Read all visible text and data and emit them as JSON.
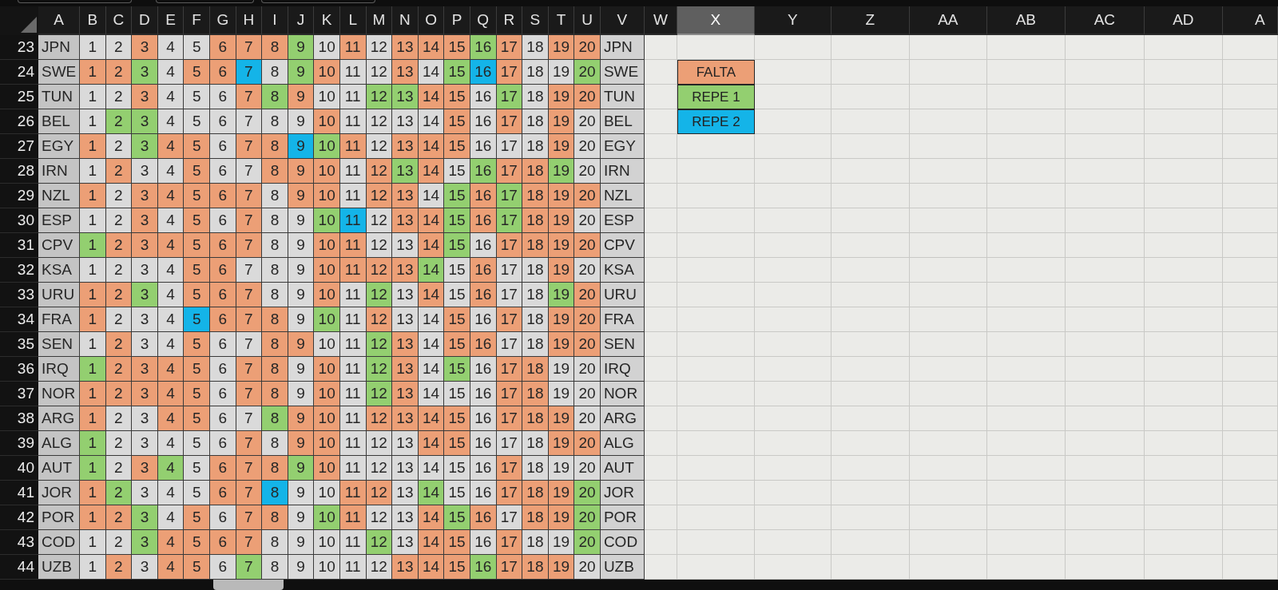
{
  "column_headers": [
    {
      "label": "A",
      "selected": false
    },
    {
      "label": "B",
      "selected": false
    },
    {
      "label": "C",
      "selected": false
    },
    {
      "label": "D",
      "selected": false
    },
    {
      "label": "E",
      "selected": false
    },
    {
      "label": "F",
      "selected": false
    },
    {
      "label": "G",
      "selected": false
    },
    {
      "label": "H",
      "selected": false
    },
    {
      "label": "I",
      "selected": false
    },
    {
      "label": "J",
      "selected": false
    },
    {
      "label": "K",
      "selected": false
    },
    {
      "label": "L",
      "selected": false
    },
    {
      "label": "M",
      "selected": false
    },
    {
      "label": "N",
      "selected": false
    },
    {
      "label": "O",
      "selected": false
    },
    {
      "label": "P",
      "selected": false
    },
    {
      "label": "Q",
      "selected": false
    },
    {
      "label": "R",
      "selected": false
    },
    {
      "label": "S",
      "selected": false
    },
    {
      "label": "T",
      "selected": false
    },
    {
      "label": "U",
      "selected": false
    },
    {
      "label": "V",
      "selected": false
    },
    {
      "label": "W",
      "selected": false
    },
    {
      "label": "X",
      "selected": true
    },
    {
      "label": "Y",
      "selected": false
    },
    {
      "label": "Z",
      "selected": false
    },
    {
      "label": "AA",
      "selected": false
    },
    {
      "label": "AB",
      "selected": false
    },
    {
      "label": "AC",
      "selected": false
    },
    {
      "label": "AD",
      "selected": false
    },
    {
      "label": "A",
      "selected": false
    }
  ],
  "rows": [
    {
      "number": "23",
      "team": "JPN",
      "cells": [
        {
          "text": "1",
          "color": "#dadada"
        },
        {
          "text": "2",
          "color": "#dadada"
        },
        {
          "text": "3",
          "color": "#ec9f76"
        },
        {
          "text": "4",
          "color": "#dadada"
        },
        {
          "text": "5",
          "color": "#dadada"
        },
        {
          "text": "6",
          "color": "#ec9f76"
        },
        {
          "text": "7",
          "color": "#ec9f76"
        },
        {
          "text": "8",
          "color": "#ec9f76"
        },
        {
          "text": "9",
          "color": "#93cf70"
        },
        {
          "text": "10",
          "color": "#dadada"
        },
        {
          "text": "11",
          "color": "#ec9f76"
        },
        {
          "text": "12",
          "color": "#dadada"
        },
        {
          "text": "13",
          "color": "#ec9f76"
        },
        {
          "text": "14",
          "color": "#ec9f76"
        },
        {
          "text": "15",
          "color": "#ec9f76"
        },
        {
          "text": "16",
          "color": "#93cf70"
        },
        {
          "text": "17",
          "color": "#ec9f76"
        },
        {
          "text": "18",
          "color": "#dadada"
        },
        {
          "text": "19",
          "color": "#ec9f76"
        },
        {
          "text": "20",
          "color": "#ec9f76"
        }
      ],
      "team_end": "JPN"
    },
    {
      "number": "24",
      "team": "SWE",
      "cells": [
        {
          "text": "1",
          "color": "#ec9f76"
        },
        {
          "text": "2",
          "color": "#ec9f76"
        },
        {
          "text": "3",
          "color": "#93cf70"
        },
        {
          "text": "4",
          "color": "#dadada"
        },
        {
          "text": "5",
          "color": "#ec9f76"
        },
        {
          "text": "6",
          "color": "#ec9f76"
        },
        {
          "text": "7",
          "color": "#14b4e8"
        },
        {
          "text": "8",
          "color": "#dadada"
        },
        {
          "text": "9",
          "color": "#93cf70"
        },
        {
          "text": "10",
          "color": "#ec9f76"
        },
        {
          "text": "11",
          "color": "#dadada"
        },
        {
          "text": "12",
          "color": "#dadada"
        },
        {
          "text": "13",
          "color": "#ec9f76"
        },
        {
          "text": "14",
          "color": "#dadada"
        },
        {
          "text": "15",
          "color": "#93cf70"
        },
        {
          "text": "16",
          "color": "#14b4e8"
        },
        {
          "text": "17",
          "color": "#ec9f76"
        },
        {
          "text": "18",
          "color": "#dadada"
        },
        {
          "text": "19",
          "color": "#dadada"
        },
        {
          "text": "20",
          "color": "#93cf70"
        }
      ],
      "team_end": "SWE"
    },
    {
      "number": "25",
      "team": "TUN",
      "cells": [
        {
          "text": "1",
          "color": "#dadada"
        },
        {
          "text": "2",
          "color": "#dadada"
        },
        {
          "text": "3",
          "color": "#ec9f76"
        },
        {
          "text": "4",
          "color": "#dadada"
        },
        {
          "text": "5",
          "color": "#dadada"
        },
        {
          "text": "6",
          "color": "#dadada"
        },
        {
          "text": "7",
          "color": "#ec9f76"
        },
        {
          "text": "8",
          "color": "#93cf70"
        },
        {
          "text": "9",
          "color": "#ec9f76"
        },
        {
          "text": "10",
          "color": "#dadada"
        },
        {
          "text": "11",
          "color": "#dadada"
        },
        {
          "text": "12",
          "color": "#93cf70"
        },
        {
          "text": "13",
          "color": "#93cf70"
        },
        {
          "text": "14",
          "color": "#ec9f76"
        },
        {
          "text": "15",
          "color": "#ec9f76"
        },
        {
          "text": "16",
          "color": "#dadada"
        },
        {
          "text": "17",
          "color": "#93cf70"
        },
        {
          "text": "18",
          "color": "#dadada"
        },
        {
          "text": "19",
          "color": "#ec9f76"
        },
        {
          "text": "20",
          "color": "#ec9f76"
        }
      ],
      "team_end": "TUN"
    },
    {
      "number": "26",
      "team": "BEL",
      "cells": [
        {
          "text": "1",
          "color": "#dadada"
        },
        {
          "text": "2",
          "color": "#93cf70"
        },
        {
          "text": "3",
          "color": "#93cf70"
        },
        {
          "text": "4",
          "color": "#dadada"
        },
        {
          "text": "5",
          "color": "#dadada"
        },
        {
          "text": "6",
          "color": "#dadada"
        },
        {
          "text": "7",
          "color": "#dadada"
        },
        {
          "text": "8",
          "color": "#dadada"
        },
        {
          "text": "9",
          "color": "#dadada"
        },
        {
          "text": "10",
          "color": "#ec9f76"
        },
        {
          "text": "11",
          "color": "#dadada"
        },
        {
          "text": "12",
          "color": "#dadada"
        },
        {
          "text": "13",
          "color": "#dadada"
        },
        {
          "text": "14",
          "color": "#dadada"
        },
        {
          "text": "15",
          "color": "#ec9f76"
        },
        {
          "text": "16",
          "color": "#dadada"
        },
        {
          "text": "17",
          "color": "#ec9f76"
        },
        {
          "text": "18",
          "color": "#dadada"
        },
        {
          "text": "19",
          "color": "#ec9f76"
        },
        {
          "text": "20",
          "color": "#dadada"
        }
      ],
      "team_end": "BEL"
    },
    {
      "number": "27",
      "team": "EGY",
      "cells": [
        {
          "text": "1",
          "color": "#ec9f76"
        },
        {
          "text": "2",
          "color": "#dadada"
        },
        {
          "text": "3",
          "color": "#93cf70"
        },
        {
          "text": "4",
          "color": "#ec9f76"
        },
        {
          "text": "5",
          "color": "#ec9f76"
        },
        {
          "text": "6",
          "color": "#dadada"
        },
        {
          "text": "7",
          "color": "#ec9f76"
        },
        {
          "text": "8",
          "color": "#ec9f76"
        },
        {
          "text": "9",
          "color": "#14b4e8"
        },
        {
          "text": "10",
          "color": "#93cf70"
        },
        {
          "text": "11",
          "color": "#ec9f76"
        },
        {
          "text": "12",
          "color": "#dadada"
        },
        {
          "text": "13",
          "color": "#ec9f76"
        },
        {
          "text": "14",
          "color": "#ec9f76"
        },
        {
          "text": "15",
          "color": "#ec9f76"
        },
        {
          "text": "16",
          "color": "#dadada"
        },
        {
          "text": "17",
          "color": "#dadada"
        },
        {
          "text": "18",
          "color": "#dadada"
        },
        {
          "text": "19",
          "color": "#ec9f76"
        },
        {
          "text": "20",
          "color": "#dadada"
        }
      ],
      "team_end": "EGY"
    },
    {
      "number": "28",
      "team": "IRN",
      "cells": [
        {
          "text": "1",
          "color": "#dadada"
        },
        {
          "text": "2",
          "color": "#ec9f76"
        },
        {
          "text": "3",
          "color": "#dadada"
        },
        {
          "text": "4",
          "color": "#dadada"
        },
        {
          "text": "5",
          "color": "#ec9f76"
        },
        {
          "text": "6",
          "color": "#dadada"
        },
        {
          "text": "7",
          "color": "#dadada"
        },
        {
          "text": "8",
          "color": "#ec9f76"
        },
        {
          "text": "9",
          "color": "#ec9f76"
        },
        {
          "text": "10",
          "color": "#ec9f76"
        },
        {
          "text": "11",
          "color": "#dadada"
        },
        {
          "text": "12",
          "color": "#ec9f76"
        },
        {
          "text": "13",
          "color": "#93cf70"
        },
        {
          "text": "14",
          "color": "#ec9f76"
        },
        {
          "text": "15",
          "color": "#dadada"
        },
        {
          "text": "16",
          "color": "#93cf70"
        },
        {
          "text": "17",
          "color": "#ec9f76"
        },
        {
          "text": "18",
          "color": "#ec9f76"
        },
        {
          "text": "19",
          "color": "#93cf70"
        },
        {
          "text": "20",
          "color": "#dadada"
        }
      ],
      "team_end": "IRN"
    },
    {
      "number": "29",
      "team": "NZL",
      "cells": [
        {
          "text": "1",
          "color": "#ec9f76"
        },
        {
          "text": "2",
          "color": "#dadada"
        },
        {
          "text": "3",
          "color": "#ec9f76"
        },
        {
          "text": "4",
          "color": "#ec9f76"
        },
        {
          "text": "5",
          "color": "#ec9f76"
        },
        {
          "text": "6",
          "color": "#ec9f76"
        },
        {
          "text": "7",
          "color": "#ec9f76"
        },
        {
          "text": "8",
          "color": "#dadada"
        },
        {
          "text": "9",
          "color": "#ec9f76"
        },
        {
          "text": "10",
          "color": "#ec9f76"
        },
        {
          "text": "11",
          "color": "#dadada"
        },
        {
          "text": "12",
          "color": "#ec9f76"
        },
        {
          "text": "13",
          "color": "#ec9f76"
        },
        {
          "text": "14",
          "color": "#dadada"
        },
        {
          "text": "15",
          "color": "#93cf70"
        },
        {
          "text": "16",
          "color": "#ec9f76"
        },
        {
          "text": "17",
          "color": "#93cf70"
        },
        {
          "text": "18",
          "color": "#ec9f76"
        },
        {
          "text": "19",
          "color": "#ec9f76"
        },
        {
          "text": "20",
          "color": "#ec9f76"
        }
      ],
      "team_end": "NZL"
    },
    {
      "number": "30",
      "team": "ESP",
      "cells": [
        {
          "text": "1",
          "color": "#dadada"
        },
        {
          "text": "2",
          "color": "#dadada"
        },
        {
          "text": "3",
          "color": "#ec9f76"
        },
        {
          "text": "4",
          "color": "#dadada"
        },
        {
          "text": "5",
          "color": "#ec9f76"
        },
        {
          "text": "6",
          "color": "#dadada"
        },
        {
          "text": "7",
          "color": "#ec9f76"
        },
        {
          "text": "8",
          "color": "#dadada"
        },
        {
          "text": "9",
          "color": "#dadada"
        },
        {
          "text": "10",
          "color": "#93cf70"
        },
        {
          "text": "11",
          "color": "#14b4e8"
        },
        {
          "text": "12",
          "color": "#dadada"
        },
        {
          "text": "13",
          "color": "#ec9f76"
        },
        {
          "text": "14",
          "color": "#ec9f76"
        },
        {
          "text": "15",
          "color": "#93cf70"
        },
        {
          "text": "16",
          "color": "#ec9f76"
        },
        {
          "text": "17",
          "color": "#93cf70"
        },
        {
          "text": "18",
          "color": "#ec9f76"
        },
        {
          "text": "19",
          "color": "#ec9f76"
        },
        {
          "text": "20",
          "color": "#dadada"
        }
      ],
      "team_end": "ESP"
    },
    {
      "number": "31",
      "team": "CPV",
      "cells": [
        {
          "text": "1",
          "color": "#93cf70"
        },
        {
          "text": "2",
          "color": "#ec9f76"
        },
        {
          "text": "3",
          "color": "#ec9f76"
        },
        {
          "text": "4",
          "color": "#ec9f76"
        },
        {
          "text": "5",
          "color": "#ec9f76"
        },
        {
          "text": "6",
          "color": "#ec9f76"
        },
        {
          "text": "7",
          "color": "#ec9f76"
        },
        {
          "text": "8",
          "color": "#dadada"
        },
        {
          "text": "9",
          "color": "#dadada"
        },
        {
          "text": "10",
          "color": "#ec9f76"
        },
        {
          "text": "11",
          "color": "#ec9f76"
        },
        {
          "text": "12",
          "color": "#dadada"
        },
        {
          "text": "13",
          "color": "#dadada"
        },
        {
          "text": "14",
          "color": "#ec9f76"
        },
        {
          "text": "15",
          "color": "#93cf70"
        },
        {
          "text": "16",
          "color": "#dadada"
        },
        {
          "text": "17",
          "color": "#ec9f76"
        },
        {
          "text": "18",
          "color": "#ec9f76"
        },
        {
          "text": "19",
          "color": "#ec9f76"
        },
        {
          "text": "20",
          "color": "#ec9f76"
        }
      ],
      "team_end": "CPV"
    },
    {
      "number": "32",
      "team": "KSA",
      "cells": [
        {
          "text": "1",
          "color": "#dadada"
        },
        {
          "text": "2",
          "color": "#dadada"
        },
        {
          "text": "3",
          "color": "#dadada"
        },
        {
          "text": "4",
          "color": "#dadada"
        },
        {
          "text": "5",
          "color": "#ec9f76"
        },
        {
          "text": "6",
          "color": "#ec9f76"
        },
        {
          "text": "7",
          "color": "#dadada"
        },
        {
          "text": "8",
          "color": "#dadada"
        },
        {
          "text": "9",
          "color": "#dadada"
        },
        {
          "text": "10",
          "color": "#ec9f76"
        },
        {
          "text": "11",
          "color": "#ec9f76"
        },
        {
          "text": "12",
          "color": "#ec9f76"
        },
        {
          "text": "13",
          "color": "#ec9f76"
        },
        {
          "text": "14",
          "color": "#93cf70"
        },
        {
          "text": "15",
          "color": "#dadada"
        },
        {
          "text": "16",
          "color": "#ec9f76"
        },
        {
          "text": "17",
          "color": "#dadada"
        },
        {
          "text": "18",
          "color": "#dadada"
        },
        {
          "text": "19",
          "color": "#ec9f76"
        },
        {
          "text": "20",
          "color": "#dadada"
        }
      ],
      "team_end": "KSA"
    },
    {
      "number": "33",
      "team": "URU",
      "cells": [
        {
          "text": "1",
          "color": "#ec9f76"
        },
        {
          "text": "2",
          "color": "#ec9f76"
        },
        {
          "text": "3",
          "color": "#93cf70"
        },
        {
          "text": "4",
          "color": "#dadada"
        },
        {
          "text": "5",
          "color": "#ec9f76"
        },
        {
          "text": "6",
          "color": "#ec9f76"
        },
        {
          "text": "7",
          "color": "#ec9f76"
        },
        {
          "text": "8",
          "color": "#dadada"
        },
        {
          "text": "9",
          "color": "#dadada"
        },
        {
          "text": "10",
          "color": "#ec9f76"
        },
        {
          "text": "11",
          "color": "#dadada"
        },
        {
          "text": "12",
          "color": "#93cf70"
        },
        {
          "text": "13",
          "color": "#dadada"
        },
        {
          "text": "14",
          "color": "#ec9f76"
        },
        {
          "text": "15",
          "color": "#dadada"
        },
        {
          "text": "16",
          "color": "#ec9f76"
        },
        {
          "text": "17",
          "color": "#dadada"
        },
        {
          "text": "18",
          "color": "#dadada"
        },
        {
          "text": "19",
          "color": "#93cf70"
        },
        {
          "text": "20",
          "color": "#ec9f76"
        }
      ],
      "team_end": "URU"
    },
    {
      "number": "34",
      "team": "FRA",
      "cells": [
        {
          "text": "1",
          "color": "#ec9f76"
        },
        {
          "text": "2",
          "color": "#dadada"
        },
        {
          "text": "3",
          "color": "#dadada"
        },
        {
          "text": "4",
          "color": "#dadada"
        },
        {
          "text": "5",
          "color": "#14b4e8"
        },
        {
          "text": "6",
          "color": "#ec9f76"
        },
        {
          "text": "7",
          "color": "#ec9f76"
        },
        {
          "text": "8",
          "color": "#ec9f76"
        },
        {
          "text": "9",
          "color": "#dadada"
        },
        {
          "text": "10",
          "color": "#93cf70"
        },
        {
          "text": "11",
          "color": "#dadada"
        },
        {
          "text": "12",
          "color": "#ec9f76"
        },
        {
          "text": "13",
          "color": "#dadada"
        },
        {
          "text": "14",
          "color": "#dadada"
        },
        {
          "text": "15",
          "color": "#ec9f76"
        },
        {
          "text": "16",
          "color": "#dadada"
        },
        {
          "text": "17",
          "color": "#ec9f76"
        },
        {
          "text": "18",
          "color": "#dadada"
        },
        {
          "text": "19",
          "color": "#ec9f76"
        },
        {
          "text": "20",
          "color": "#ec9f76"
        }
      ],
      "team_end": "FRA"
    },
    {
      "number": "35",
      "team": "SEN",
      "cells": [
        {
          "text": "1",
          "color": "#dadada"
        },
        {
          "text": "2",
          "color": "#ec9f76"
        },
        {
          "text": "3",
          "color": "#dadada"
        },
        {
          "text": "4",
          "color": "#dadada"
        },
        {
          "text": "5",
          "color": "#ec9f76"
        },
        {
          "text": "6",
          "color": "#dadada"
        },
        {
          "text": "7",
          "color": "#dadada"
        },
        {
          "text": "8",
          "color": "#ec9f76"
        },
        {
          "text": "9",
          "color": "#ec9f76"
        },
        {
          "text": "10",
          "color": "#dadada"
        },
        {
          "text": "11",
          "color": "#dadada"
        },
        {
          "text": "12",
          "color": "#93cf70"
        },
        {
          "text": "13",
          "color": "#ec9f76"
        },
        {
          "text": "14",
          "color": "#dadada"
        },
        {
          "text": "15",
          "color": "#ec9f76"
        },
        {
          "text": "16",
          "color": "#ec9f76"
        },
        {
          "text": "17",
          "color": "#dadada"
        },
        {
          "text": "18",
          "color": "#dadada"
        },
        {
          "text": "19",
          "color": "#ec9f76"
        },
        {
          "text": "20",
          "color": "#ec9f76"
        }
      ],
      "team_end": "SEN"
    },
    {
      "number": "36",
      "team": "IRQ",
      "cells": [
        {
          "text": "1",
          "color": "#93cf70"
        },
        {
          "text": "2",
          "color": "#ec9f76"
        },
        {
          "text": "3",
          "color": "#ec9f76"
        },
        {
          "text": "4",
          "color": "#ec9f76"
        },
        {
          "text": "5",
          "color": "#ec9f76"
        },
        {
          "text": "6",
          "color": "#dadada"
        },
        {
          "text": "7",
          "color": "#ec9f76"
        },
        {
          "text": "8",
          "color": "#ec9f76"
        },
        {
          "text": "9",
          "color": "#dadada"
        },
        {
          "text": "10",
          "color": "#ec9f76"
        },
        {
          "text": "11",
          "color": "#dadada"
        },
        {
          "text": "12",
          "color": "#93cf70"
        },
        {
          "text": "13",
          "color": "#ec9f76"
        },
        {
          "text": "14",
          "color": "#dadada"
        },
        {
          "text": "15",
          "color": "#93cf70"
        },
        {
          "text": "16",
          "color": "#dadada"
        },
        {
          "text": "17",
          "color": "#ec9f76"
        },
        {
          "text": "18",
          "color": "#ec9f76"
        },
        {
          "text": "19",
          "color": "#dadada"
        },
        {
          "text": "20",
          "color": "#dadada"
        }
      ],
      "team_end": "IRQ"
    },
    {
      "number": "37",
      "team": "NOR",
      "cells": [
        {
          "text": "1",
          "color": "#ec9f76"
        },
        {
          "text": "2",
          "color": "#ec9f76"
        },
        {
          "text": "3",
          "color": "#ec9f76"
        },
        {
          "text": "4",
          "color": "#ec9f76"
        },
        {
          "text": "5",
          "color": "#ec9f76"
        },
        {
          "text": "6",
          "color": "#dadada"
        },
        {
          "text": "7",
          "color": "#ec9f76"
        },
        {
          "text": "8",
          "color": "#ec9f76"
        },
        {
          "text": "9",
          "color": "#dadada"
        },
        {
          "text": "10",
          "color": "#ec9f76"
        },
        {
          "text": "11",
          "color": "#dadada"
        },
        {
          "text": "12",
          "color": "#93cf70"
        },
        {
          "text": "13",
          "color": "#ec9f76"
        },
        {
          "text": "14",
          "color": "#dadada"
        },
        {
          "text": "15",
          "color": "#dadada"
        },
        {
          "text": "16",
          "color": "#dadada"
        },
        {
          "text": "17",
          "color": "#ec9f76"
        },
        {
          "text": "18",
          "color": "#ec9f76"
        },
        {
          "text": "19",
          "color": "#dadada"
        },
        {
          "text": "20",
          "color": "#dadada"
        }
      ],
      "team_end": "NOR"
    },
    {
      "number": "38",
      "team": "ARG",
      "cells": [
        {
          "text": "1",
          "color": "#ec9f76"
        },
        {
          "text": "2",
          "color": "#dadada"
        },
        {
          "text": "3",
          "color": "#dadada"
        },
        {
          "text": "4",
          "color": "#ec9f76"
        },
        {
          "text": "5",
          "color": "#ec9f76"
        },
        {
          "text": "6",
          "color": "#dadada"
        },
        {
          "text": "7",
          "color": "#dadada"
        },
        {
          "text": "8",
          "color": "#93cf70"
        },
        {
          "text": "9",
          "color": "#ec9f76"
        },
        {
          "text": "10",
          "color": "#ec9f76"
        },
        {
          "text": "11",
          "color": "#dadada"
        },
        {
          "text": "12",
          "color": "#ec9f76"
        },
        {
          "text": "13",
          "color": "#ec9f76"
        },
        {
          "text": "14",
          "color": "#ec9f76"
        },
        {
          "text": "15",
          "color": "#ec9f76"
        },
        {
          "text": "16",
          "color": "#dadada"
        },
        {
          "text": "17",
          "color": "#ec9f76"
        },
        {
          "text": "18",
          "color": "#ec9f76"
        },
        {
          "text": "19",
          "color": "#ec9f76"
        },
        {
          "text": "20",
          "color": "#dadada"
        }
      ],
      "team_end": "ARG"
    },
    {
      "number": "39",
      "team": "ALG",
      "cells": [
        {
          "text": "1",
          "color": "#93cf70"
        },
        {
          "text": "2",
          "color": "#dadada"
        },
        {
          "text": "3",
          "color": "#dadada"
        },
        {
          "text": "4",
          "color": "#dadada"
        },
        {
          "text": "5",
          "color": "#dadada"
        },
        {
          "text": "6",
          "color": "#dadada"
        },
        {
          "text": "7",
          "color": "#ec9f76"
        },
        {
          "text": "8",
          "color": "#dadada"
        },
        {
          "text": "9",
          "color": "#ec9f76"
        },
        {
          "text": "10",
          "color": "#ec9f76"
        },
        {
          "text": "11",
          "color": "#dadada"
        },
        {
          "text": "12",
          "color": "#dadada"
        },
        {
          "text": "13",
          "color": "#dadada"
        },
        {
          "text": "14",
          "color": "#ec9f76"
        },
        {
          "text": "15",
          "color": "#ec9f76"
        },
        {
          "text": "16",
          "color": "#dadada"
        },
        {
          "text": "17",
          "color": "#dadada"
        },
        {
          "text": "18",
          "color": "#dadada"
        },
        {
          "text": "19",
          "color": "#ec9f76"
        },
        {
          "text": "20",
          "color": "#ec9f76"
        }
      ],
      "team_end": "ALG"
    },
    {
      "number": "40",
      "team": "AUT",
      "cells": [
        {
          "text": "1",
          "color": "#93cf70"
        },
        {
          "text": "2",
          "color": "#dadada"
        },
        {
          "text": "3",
          "color": "#ec9f76"
        },
        {
          "text": "4",
          "color": "#93cf70"
        },
        {
          "text": "5",
          "color": "#dadada"
        },
        {
          "text": "6",
          "color": "#ec9f76"
        },
        {
          "text": "7",
          "color": "#ec9f76"
        },
        {
          "text": "8",
          "color": "#ec9f76"
        },
        {
          "text": "9",
          "color": "#93cf70"
        },
        {
          "text": "10",
          "color": "#ec9f76"
        },
        {
          "text": "11",
          "color": "#dadada"
        },
        {
          "text": "12",
          "color": "#dadada"
        },
        {
          "text": "13",
          "color": "#dadada"
        },
        {
          "text": "14",
          "color": "#dadada"
        },
        {
          "text": "15",
          "color": "#dadada"
        },
        {
          "text": "16",
          "color": "#dadada"
        },
        {
          "text": "17",
          "color": "#ec9f76"
        },
        {
          "text": "18",
          "color": "#dadada"
        },
        {
          "text": "19",
          "color": "#dadada"
        },
        {
          "text": "20",
          "color": "#dadada"
        }
      ],
      "team_end": "AUT"
    },
    {
      "number": "41",
      "team": "JOR",
      "cells": [
        {
          "text": "1",
          "color": "#ec9f76"
        },
        {
          "text": "2",
          "color": "#93cf70"
        },
        {
          "text": "3",
          "color": "#dadada"
        },
        {
          "text": "4",
          "color": "#dadada"
        },
        {
          "text": "5",
          "color": "#dadada"
        },
        {
          "text": "6",
          "color": "#ec9f76"
        },
        {
          "text": "7",
          "color": "#ec9f76"
        },
        {
          "text": "8",
          "color": "#14b4e8"
        },
        {
          "text": "9",
          "color": "#dadada"
        },
        {
          "text": "10",
          "color": "#dadada"
        },
        {
          "text": "11",
          "color": "#ec9f76"
        },
        {
          "text": "12",
          "color": "#ec9f76"
        },
        {
          "text": "13",
          "color": "#dadada"
        },
        {
          "text": "14",
          "color": "#93cf70"
        },
        {
          "text": "15",
          "color": "#dadada"
        },
        {
          "text": "16",
          "color": "#dadada"
        },
        {
          "text": "17",
          "color": "#ec9f76"
        },
        {
          "text": "18",
          "color": "#ec9f76"
        },
        {
          "text": "19",
          "color": "#ec9f76"
        },
        {
          "text": "20",
          "color": "#93cf70"
        }
      ],
      "team_end": "JOR"
    },
    {
      "number": "42",
      "team": "POR",
      "cells": [
        {
          "text": "1",
          "color": "#ec9f76"
        },
        {
          "text": "2",
          "color": "#ec9f76"
        },
        {
          "text": "3",
          "color": "#93cf70"
        },
        {
          "text": "4",
          "color": "#dadada"
        },
        {
          "text": "5",
          "color": "#ec9f76"
        },
        {
          "text": "6",
          "color": "#dadada"
        },
        {
          "text": "7",
          "color": "#ec9f76"
        },
        {
          "text": "8",
          "color": "#ec9f76"
        },
        {
          "text": "9",
          "color": "#dadada"
        },
        {
          "text": "10",
          "color": "#93cf70"
        },
        {
          "text": "11",
          "color": "#ec9f76"
        },
        {
          "text": "12",
          "color": "#dadada"
        },
        {
          "text": "13",
          "color": "#dadada"
        },
        {
          "text": "14",
          "color": "#ec9f76"
        },
        {
          "text": "15",
          "color": "#93cf70"
        },
        {
          "text": "16",
          "color": "#ec9f76"
        },
        {
          "text": "17",
          "color": "#dadada"
        },
        {
          "text": "18",
          "color": "#ec9f76"
        },
        {
          "text": "19",
          "color": "#ec9f76"
        },
        {
          "text": "20",
          "color": "#93cf70"
        }
      ],
      "team_end": "POR"
    },
    {
      "number": "43",
      "team": "COD",
      "cells": [
        {
          "text": "1",
          "color": "#dadada"
        },
        {
          "text": "2",
          "color": "#dadada"
        },
        {
          "text": "3",
          "color": "#93cf70"
        },
        {
          "text": "4",
          "color": "#ec9f76"
        },
        {
          "text": "5",
          "color": "#ec9f76"
        },
        {
          "text": "6",
          "color": "#ec9f76"
        },
        {
          "text": "7",
          "color": "#ec9f76"
        },
        {
          "text": "8",
          "color": "#dadada"
        },
        {
          "text": "9",
          "color": "#dadada"
        },
        {
          "text": "10",
          "color": "#dadada"
        },
        {
          "text": "11",
          "color": "#dadada"
        },
        {
          "text": "12",
          "color": "#93cf70"
        },
        {
          "text": "13",
          "color": "#dadada"
        },
        {
          "text": "14",
          "color": "#ec9f76"
        },
        {
          "text": "15",
          "color": "#ec9f76"
        },
        {
          "text": "16",
          "color": "#dadada"
        },
        {
          "text": "17",
          "color": "#ec9f76"
        },
        {
          "text": "18",
          "color": "#dadada"
        },
        {
          "text": "19",
          "color": "#dadada"
        },
        {
          "text": "20",
          "color": "#93cf70"
        }
      ],
      "team_end": "COD"
    },
    {
      "number": "44",
      "team": "UZB",
      "cells": [
        {
          "text": "1",
          "color": "#dadada"
        },
        {
          "text": "2",
          "color": "#ec9f76"
        },
        {
          "text": "3",
          "color": "#dadada"
        },
        {
          "text": "4",
          "color": "#ec9f76"
        },
        {
          "text": "5",
          "color": "#ec9f76"
        },
        {
          "text": "6",
          "color": "#dadada"
        },
        {
          "text": "7",
          "color": "#93cf70"
        },
        {
          "text": "8",
          "color": "#dadada"
        },
        {
          "text": "9",
          "color": "#dadada"
        },
        {
          "text": "10",
          "color": "#dadada"
        },
        {
          "text": "11",
          "color": "#dadada"
        },
        {
          "text": "12",
          "color": "#dadada"
        },
        {
          "text": "13",
          "color": "#ec9f76"
        },
        {
          "text": "14",
          "color": "#ec9f76"
        },
        {
          "text": "15",
          "color": "#ec9f76"
        },
        {
          "text": "16",
          "color": "#93cf70"
        },
        {
          "text": "17",
          "color": "#ec9f76"
        },
        {
          "text": "18",
          "color": "#ec9f76"
        },
        {
          "text": "19",
          "color": "#ec9f76"
        },
        {
          "text": "20",
          "color": "#dadada"
        }
      ],
      "team_end": "UZB"
    }
  ],
  "legend": [
    {
      "label": "FALTA",
      "color": "#ec9f76"
    },
    {
      "label": "REPE 1",
      "color": "#93cf70"
    },
    {
      "label": "REPE 2",
      "color": "#14b4e8"
    }
  ]
}
